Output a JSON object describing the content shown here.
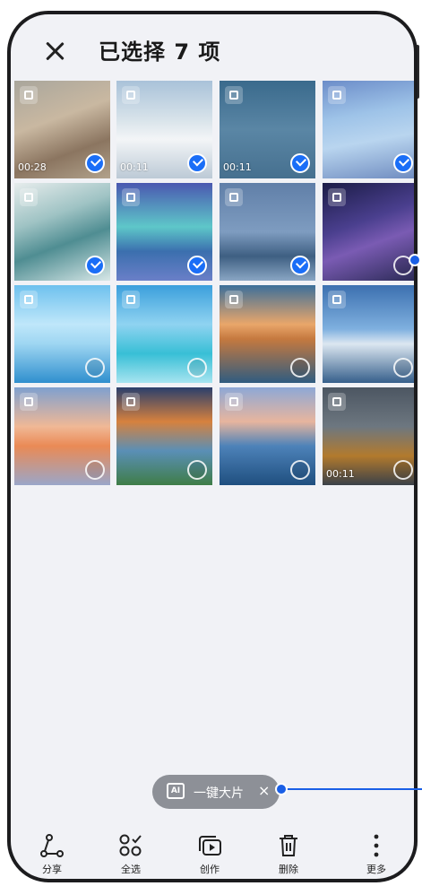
{
  "header": {
    "close_icon": "close-icon",
    "title": "已选择 7 项"
  },
  "grid": {
    "tiles": [
      {
        "bg": "linear-gradient(160deg,#a9a69c 0%,#c9b8a1 40%,#8b7560 70%,#b1a28c 100%)",
        "duration": "00:28",
        "selected": true
      },
      {
        "bg": "linear-gradient(180deg,#a9c2d9 0%,#d8e3ea 40%,#f3f5f7 60%,#bccad6 100%)",
        "duration": "00:11",
        "selected": true
      },
      {
        "bg": "linear-gradient(180deg,#3a6a8c 0%,#5a86a5 50%,#46708f 100%)",
        "duration": "00:11",
        "selected": true
      },
      {
        "bg": "linear-gradient(170deg,#6c8dc9 0%,#9ec3e8 35%,#b9d5ef 60%,#6f8cc0 100%)",
        "duration": "",
        "selected": true
      },
      {
        "bg": "linear-gradient(160deg,#e6ecec 0%,#9fc3c4 35%,#4f8d92 60%,#d7e7e7 100%)",
        "duration": "",
        "selected": true
      },
      {
        "bg": "linear-gradient(180deg,#4a58b0 0%,#5ec7c9 45%,#3b6fae 70%,#6a7fc8 100%)",
        "duration": "",
        "selected": true
      },
      {
        "bg": "linear-gradient(180deg,#607fa8 0%,#7e9cc0 50%,#3e5f82 75%,#8aa6c4 100%)",
        "duration": "",
        "selected": true
      },
      {
        "bg": "linear-gradient(160deg,#1b1c46 0%,#4a3f8e 40%,#7a5bb3 60%,#2a2a55 100%)",
        "duration": "",
        "selected": false
      },
      {
        "bg": "linear-gradient(180deg,#6ec1ee 0%,#bfe7fa 40%,#9ed6f2 60%,#2f8fce 100%)",
        "duration": "",
        "selected": false
      },
      {
        "bg": "linear-gradient(180deg,#3b9fdc 0%,#8fd3f1 40%,#38bfd6 70%,#a7e4f0 100%)",
        "duration": "",
        "selected": false
      },
      {
        "bg": "linear-gradient(180deg,#3c6f9a 0%,#e9a66a 40%,#c5793f 55%,#2f5c80 100%)",
        "duration": "",
        "selected": false
      },
      {
        "bg": "linear-gradient(180deg,#3c70b0 0%,#7fb0df 45%,#dce7f1 60%,#365f8b 100%)",
        "duration": "",
        "selected": false
      },
      {
        "bg": "linear-gradient(180deg,#7fa0cf 0%,#f0b896 40%,#ea8a55 60%,#9aa6c9 100%)",
        "duration": "",
        "selected": false
      },
      {
        "bg": "linear-gradient(180deg,#2a3f6c 0%,#d6813e 35%,#5a8fb6 65%,#3f7d47 100%)",
        "duration": "",
        "selected": false
      },
      {
        "bg": "linear-gradient(180deg,#8ea8d6 0%,#e7b59e 35%,#4d82b9 60%,#1f4f7f 100%)",
        "duration": "",
        "selected": false
      },
      {
        "bg": "linear-gradient(180deg,#4c5662 0%,#6d7780 40%,#b27a2d 70%,#3b4148 100%)",
        "duration": "00:11",
        "selected": false
      }
    ]
  },
  "pill": {
    "icon": "ai-icon",
    "icon_text": "AI",
    "label": "一键大片",
    "close": "×"
  },
  "toolbar": {
    "items": [
      {
        "name": "share",
        "icon": "share-icon",
        "label": "分享"
      },
      {
        "name": "select-all",
        "icon": "select-all-icon",
        "label": "全选"
      },
      {
        "name": "create",
        "icon": "create-icon",
        "label": "创作"
      },
      {
        "name": "delete",
        "icon": "trash-icon",
        "label": "删除"
      },
      {
        "name": "more",
        "icon": "more-icon",
        "label": "更多"
      }
    ]
  },
  "colors": {
    "accent": "#1a6ef7",
    "pointer": "#1a5fe6",
    "background": "#f1f2f6"
  }
}
